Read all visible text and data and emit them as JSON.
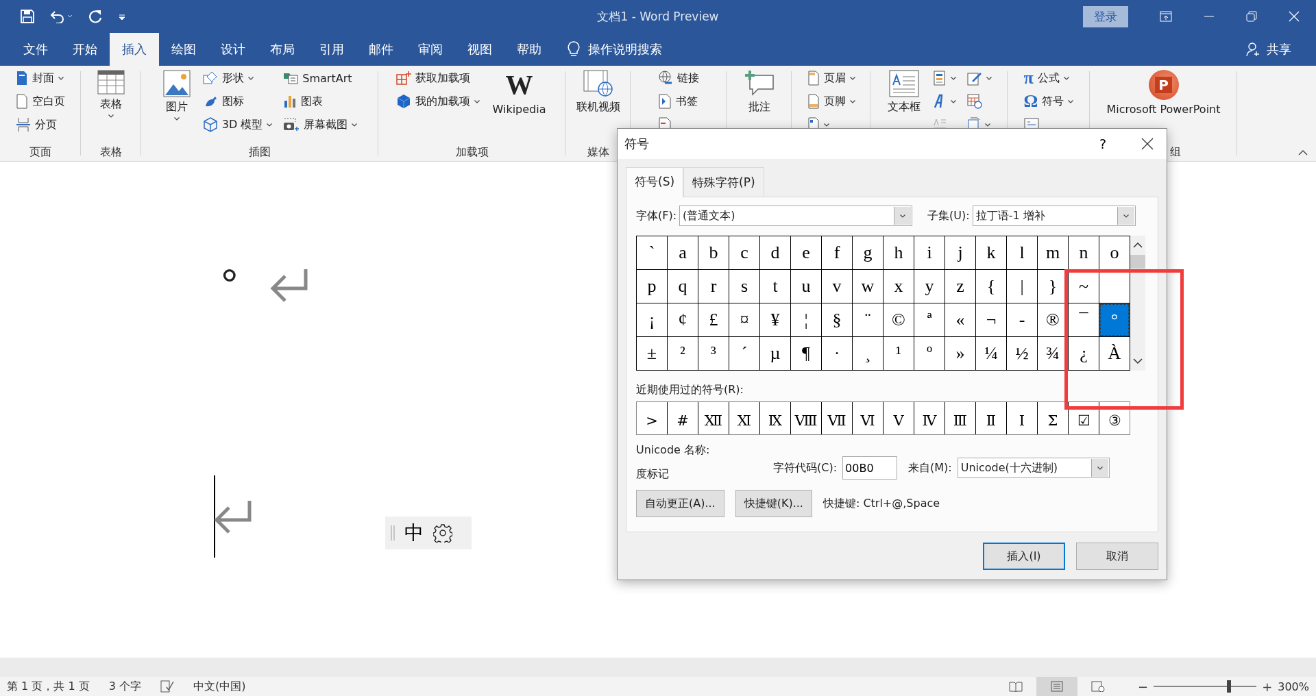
{
  "window": {
    "title": "文档1  -  Word Preview",
    "sign_in": "登录"
  },
  "tabs": [
    {
      "label": "文件",
      "selected": false
    },
    {
      "label": "开始",
      "selected": false
    },
    {
      "label": "插入",
      "selected": true
    },
    {
      "label": "绘图",
      "selected": false
    },
    {
      "label": "设计",
      "selected": false
    },
    {
      "label": "布局",
      "selected": false
    },
    {
      "label": "引用",
      "selected": false
    },
    {
      "label": "邮件",
      "selected": false
    },
    {
      "label": "审阅",
      "selected": false
    },
    {
      "label": "视图",
      "selected": false
    },
    {
      "label": "帮助",
      "selected": false
    }
  ],
  "tell_me": "操作说明搜索",
  "share": "共享",
  "ribbon": [
    {
      "label": "页面",
      "parts": [
        {
          "kind": "column",
          "items": [
            {
              "label": "封面",
              "caret": true
            },
            {
              "label": "空白页",
              "caret": false
            },
            {
              "label": "分页",
              "caret": false
            }
          ]
        }
      ]
    },
    {
      "label": "表格",
      "parts": [
        {
          "kind": "large",
          "label": "表格",
          "caret": true
        }
      ]
    },
    {
      "label": "插图",
      "parts": [
        {
          "kind": "large",
          "label": "图片",
          "caret": true
        },
        {
          "kind": "column",
          "items": [
            {
              "label": "形状",
              "caret": true
            },
            {
              "label": "图标",
              "caret": false
            },
            {
              "label": "3D 模型",
              "caret": true
            }
          ]
        },
        {
          "kind": "column",
          "items": [
            {
              "label": "SmartArt",
              "caret": false
            },
            {
              "label": "图表",
              "caret": false
            },
            {
              "label": "屏幕截图",
              "caret": true
            }
          ]
        }
      ]
    },
    {
      "label": "加载项",
      "parts": [
        {
          "kind": "column",
          "items": [
            {
              "label": "获取加载项",
              "caret": false
            },
            {
              "label": "我的加载项",
              "caret": true
            }
          ]
        },
        {
          "kind": "large",
          "label": "Wikipedia",
          "glyph": "W",
          "caret": false
        }
      ]
    },
    {
      "label": "媒体",
      "parts": [
        {
          "kind": "large",
          "label": "联机视频",
          "caret": false
        }
      ]
    },
    {
      "parts": [
        {
          "kind": "column",
          "items": [
            {
              "label": "链接",
              "caret": false
            },
            {
              "label": "书签",
              "caret": false
            },
            {
              "caret": false
            }
          ]
        }
      ]
    },
    {
      "parts": [
        {
          "kind": "large",
          "label": "批注",
          "caret": false
        }
      ]
    },
    {
      "parts": [
        {
          "kind": "column",
          "items": [
            {
              "label": "页眉",
              "caret": true
            },
            {
              "label": "页脚",
              "caret": true
            },
            {
              "caret": true
            }
          ]
        }
      ]
    },
    {
      "parts": [
        {
          "kind": "large",
          "label": "文本框",
          "caret": false
        },
        {
          "kind": "column",
          "items": [
            {
              "caret": true
            },
            {
              "caret": true
            },
            {
              "caret": false
            }
          ]
        },
        {
          "kind": "column",
          "items": [
            {
              "caret": true
            },
            {
              "caret": false
            },
            {
              "caret": true
            }
          ]
        }
      ]
    },
    {
      "parts": [
        {
          "kind": "column",
          "items": [
            {
              "label": "公式",
              "glyph": "π",
              "caret": true
            },
            {
              "label": "符号",
              "glyph": "Ω",
              "caret": true
            },
            {
              "caret": false
            }
          ]
        }
      ]
    },
    {
      "label": "组",
      "parts": [
        {
          "kind": "large",
          "label": "Microsoft PowerPoint",
          "glyph": "P",
          "caret": false
        }
      ]
    }
  ],
  "document": {
    "paragraphs": [
      {
        "text": "°",
        "cursor": false
      },
      {
        "cursor": true
      }
    ]
  },
  "ime": {
    "mode": "中"
  },
  "dialog": {
    "title": "符号",
    "help": "?",
    "tabs": [
      {
        "label": "符号(S)",
        "selected": true
      },
      {
        "label": "特殊字符(P)",
        "selected": false
      }
    ],
    "font_label": "字体(F):",
    "font": "(普通文本)",
    "subset_label": "子集(U):",
    "subset": "拉丁语-1 增补",
    "grid": [
      [
        {
          "char": "`",
          "selected": false
        },
        {
          "char": "a",
          "selected": false
        },
        {
          "char": "b",
          "selected": false
        },
        {
          "char": "c",
          "selected": false
        },
        {
          "char": "d",
          "selected": false
        },
        {
          "char": "e",
          "selected": false
        },
        {
          "char": "f",
          "selected": false
        },
        {
          "char": "g",
          "selected": false
        },
        {
          "char": "h",
          "selected": false
        },
        {
          "char": "i",
          "selected": false
        },
        {
          "char": "j",
          "selected": false
        },
        {
          "char": "k",
          "selected": false
        },
        {
          "char": "l",
          "selected": false
        },
        {
          "char": "m",
          "selected": false
        },
        {
          "char": "n",
          "selected": false
        },
        {
          "char": "o",
          "selected": false
        }
      ],
      [
        {
          "char": "p",
          "selected": false
        },
        {
          "char": "q",
          "selected": false
        },
        {
          "char": "r",
          "selected": false
        },
        {
          "char": "s",
          "selected": false
        },
        {
          "char": "t",
          "selected": false
        },
        {
          "char": "u",
          "selected": false
        },
        {
          "char": "v",
          "selected": false
        },
        {
          "char": "w",
          "selected": false
        },
        {
          "char": "x",
          "selected": false
        },
        {
          "char": "y",
          "selected": false
        },
        {
          "char": "z",
          "selected": false
        },
        {
          "char": "{",
          "selected": false
        },
        {
          "char": "|",
          "selected": false
        },
        {
          "char": "}",
          "selected": false
        },
        {
          "char": "~",
          "selected": false
        },
        {
          "selected": false
        }
      ],
      [
        {
          "char": "¡",
          "selected": false
        },
        {
          "char": "¢",
          "selected": false
        },
        {
          "char": "£",
          "selected": false
        },
        {
          "char": "¤",
          "selected": false
        },
        {
          "char": "¥",
          "selected": false
        },
        {
          "char": "¦",
          "selected": false
        },
        {
          "char": "§",
          "selected": false
        },
        {
          "char": "¨",
          "selected": false
        },
        {
          "char": "©",
          "selected": false
        },
        {
          "char": "ª",
          "selected": false
        },
        {
          "char": "«",
          "selected": false
        },
        {
          "char": "¬",
          "selected": false
        },
        {
          "char": "-",
          "selected": false
        },
        {
          "char": "®",
          "selected": false
        },
        {
          "char": "¯",
          "selected": false
        },
        {
          "char": "°",
          "selected": true
        }
      ],
      [
        {
          "char": "±",
          "selected": false
        },
        {
          "char": "²",
          "selected": false
        },
        {
          "char": "³",
          "selected": false
        },
        {
          "char": "´",
          "selected": false
        },
        {
          "char": "µ",
          "selected": false
        },
        {
          "char": "¶",
          "selected": false
        },
        {
          "char": "·",
          "selected": false
        },
        {
          "char": "¸",
          "selected": false
        },
        {
          "char": "¹",
          "selected": false
        },
        {
          "char": "º",
          "selected": false
        },
        {
          "char": "»",
          "selected": false
        },
        {
          "char": "¼",
          "selected": false
        },
        {
          "char": "½",
          "selected": false
        },
        {
          "char": "¾",
          "selected": false
        },
        {
          "char": "¿",
          "selected": false
        },
        {
          "char": "À",
          "selected": false
        }
      ]
    ],
    "recent_label": "近期使用过的符号(R):",
    "recent": [
      ">",
      "#",
      "Ⅻ",
      "Ⅺ",
      "Ⅸ",
      "Ⅷ",
      "Ⅶ",
      "Ⅵ",
      "Ⅴ",
      "Ⅳ",
      "Ⅲ",
      "Ⅱ",
      "Ⅰ",
      "Σ",
      "☑",
      "③"
    ],
    "unicode_name_label": "Unicode 名称:",
    "unicode_name": "度标记",
    "code_label": "字符代码(C):",
    "code": "00B0",
    "from_label": "来自(M):",
    "from": "Unicode(十六进制)",
    "autocorrect": "自动更正(A)...",
    "shortcut_button": "快捷键(K)...",
    "shortcut_text": "快捷键: Ctrl+@,Space",
    "insert": "插入(I)",
    "cancel": "取消"
  },
  "status_bar": {
    "page": "第 1 页，共 1 页",
    "words": "3 个字",
    "language": "中文(中国)",
    "views": [
      {
        "selected": false
      },
      {
        "selected": true
      },
      {
        "selected": false
      }
    ],
    "zoom_out": "−",
    "zoom_slider": {
      "level": 0.73
    },
    "zoom_in": "+",
    "zoom": "300%"
  }
}
